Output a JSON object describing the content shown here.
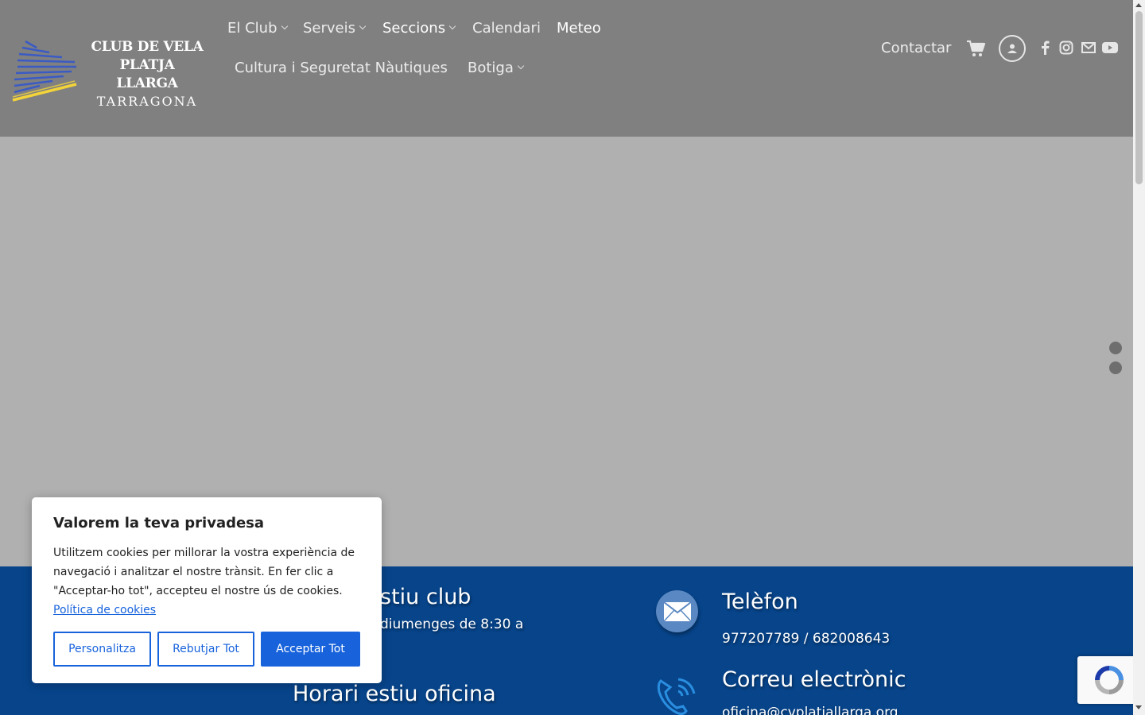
{
  "logo": {
    "line1": "CLUB DE VELA",
    "line2": "PLATJA LLARGA",
    "line3": "TARRAGONA"
  },
  "nav": {
    "items": [
      {
        "label": "El Club",
        "has_dropdown": true
      },
      {
        "label": "Serveis",
        "has_dropdown": true
      },
      {
        "label": "Seccions",
        "has_dropdown": true
      },
      {
        "label": "Calendari",
        "has_dropdown": false
      },
      {
        "label": "Meteo",
        "has_dropdown": false
      },
      {
        "label": "Cultura i Seguretat Nàutiques",
        "has_dropdown": false
      },
      {
        "label": "Botiga",
        "has_dropdown": true
      }
    ],
    "contact_label": "Contactar",
    "icons": [
      "cart-icon",
      "account-icon",
      "facebook-icon",
      "instagram-icon",
      "email-icon",
      "youtube-icon"
    ]
  },
  "slider": {
    "dots": 2
  },
  "info": {
    "summer_club_heading": "stiu club",
    "summer_club_hours": "diumenges de 8:30 a",
    "summer_office_heading": "Horari estiu oficina",
    "phone_heading": "Telèfon",
    "phone_value": "977207789 / 682008643",
    "email_heading": "Correu electrònic",
    "email_value": "oficina@cvplatjallarga.org"
  },
  "cookie": {
    "title": "Valorem la teva privadesa",
    "body": "Utilitzem cookies per millorar la vostra experiència de navegació i analitzar el nostre trànsit. En fer clic a \"Acceptar-ho tot\", accepteu el nostre ús de cookies.",
    "link_label": "Política de cookies",
    "btn_customize": "Personalitza",
    "btn_reject": "Rebutjar Tot",
    "btn_accept": "Acceptar Tot"
  },
  "colors": {
    "header_bg": "#808080",
    "hero_bg": "#b0b0b0",
    "band_bg": "#07448a",
    "accent_blue": "#1863dc",
    "logo_yellow": "#f2d43a",
    "logo_blue": "#3b5bc4"
  }
}
